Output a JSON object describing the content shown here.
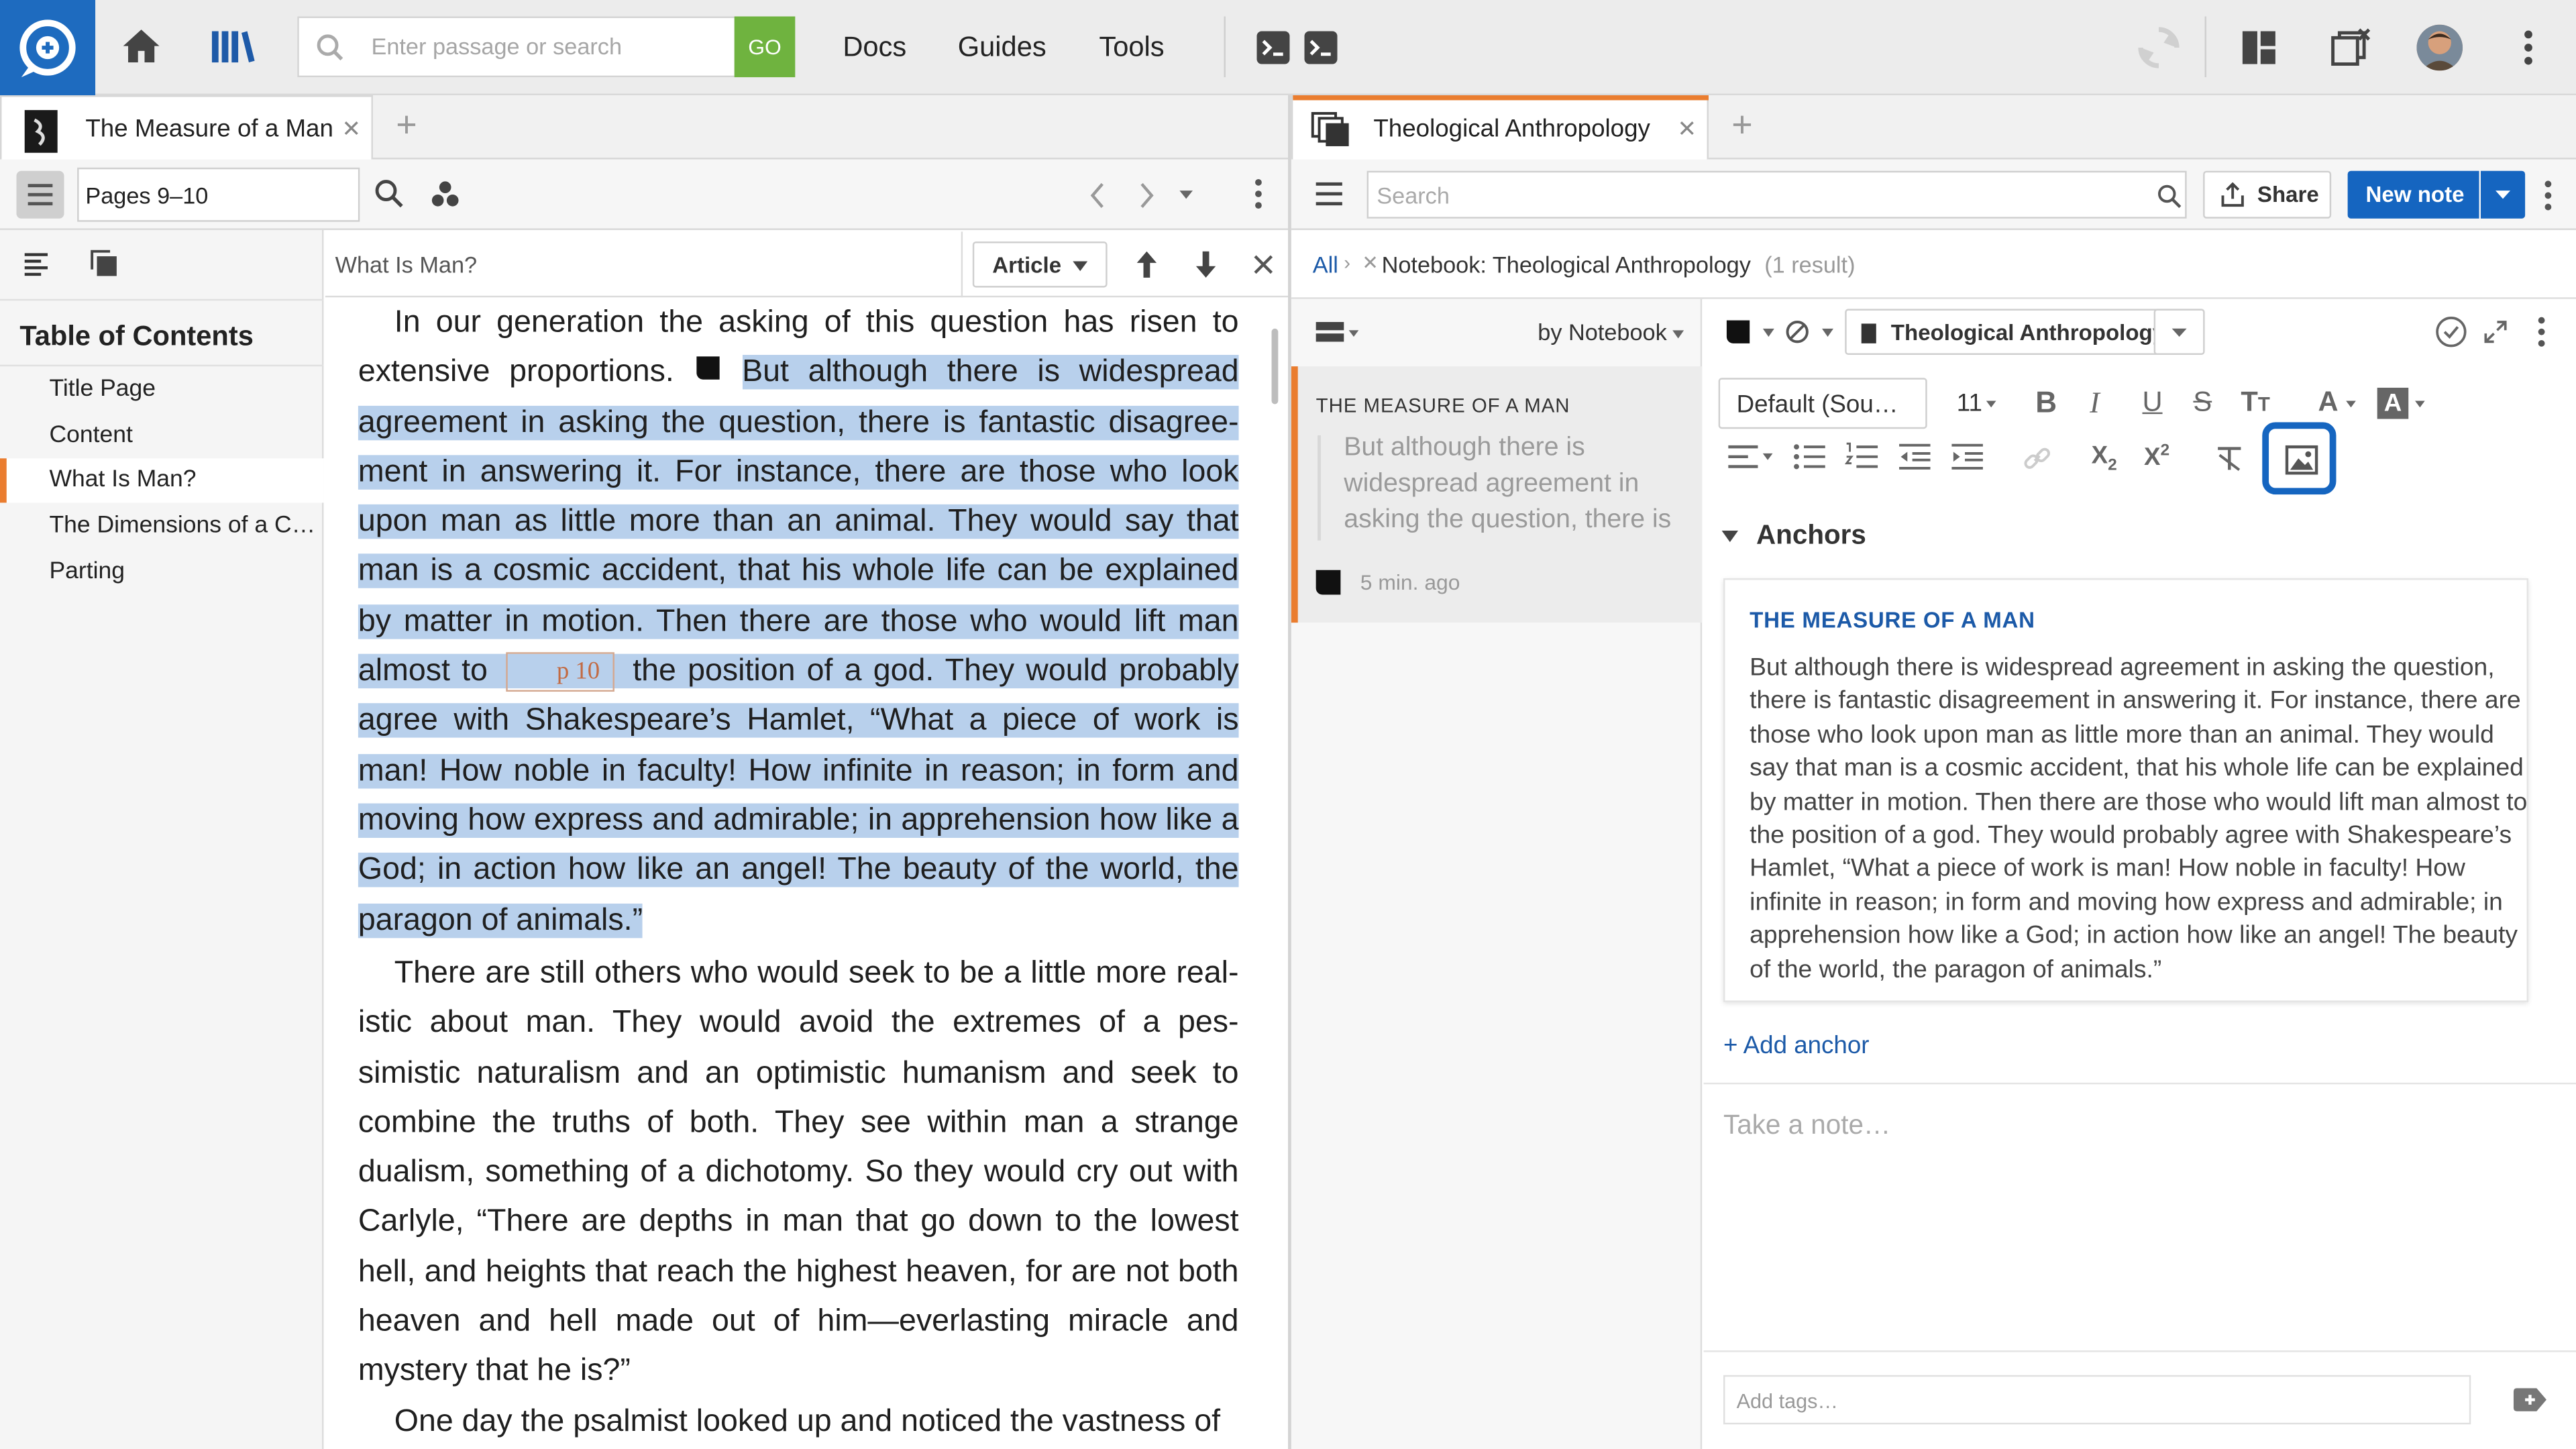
{
  "topbar": {
    "search_placeholder": "Enter passage or search",
    "go_label": "GO",
    "nav": [
      "Docs",
      "Guides",
      "Tools"
    ]
  },
  "left_panel": {
    "tab_title": "The Measure of a Man",
    "reference": "Pages 9–10",
    "toc_heading": "Table of Contents",
    "toc_items": [
      "Title Page",
      "Content",
      "What Is Man?",
      "The Dimensions of a C…",
      "Parting"
    ],
    "toc_active_index": 2,
    "find_value": "What Is Man?",
    "find_scope": "Article",
    "article": {
      "p1_a": "In our generation the asking of this question has risen to extensive proportions.",
      "p1_b": "But although there is widespread agreement in asking the question, there is fantastic disagree­ment in answering it. For instance, there are those who look upon man as little more than an animal. They would say that man is a cosmic accident, that his whole life can be explained by matter in motion. Then there are those who would lift man almost to",
      "page_marker": "p 10",
      "p1_c": "the position of a god. They would probably agree with Shakespeare’s Hamlet, “What a piece of work is man! How noble in faculty! How infinite in reason; in form and moving how express and admirable; in apprehension how like a God; in action how like an angel! The beauty of the world, the paragon of animals.”",
      "p2": "There are still others who would seek to be a little more real­istic about man. They would avoid the extremes of a pes­simistic naturalism and an optimistic humanism and seek to combine the truths of both. They see within man a strange dual­ism, something of a dichotomy. So they would cry out with Carlyle, “There are depths in man that go down to the lowest hell, and heights that reach the highest heaven, for are not both heaven and hell made out of him—everlasting miracle and mystery that he is?”",
      "p3": "One day the psalmist looked up and noticed the vastness of"
    }
  },
  "right_panel": {
    "tab_title": "Theological Anthropology",
    "search_placeholder": "Search",
    "share_label": "Share",
    "new_note_label": "New note",
    "breadcrumb": {
      "all": "All",
      "notebook": "Notebook: Theological Anthropology",
      "count": "(1 result)"
    },
    "sort_label": "by Notebook",
    "note_card": {
      "source": "THE MEASURE OF A MAN",
      "excerpt": "But although there is widespread agreement in asking the question, there is",
      "time": "5 min. ago"
    },
    "editor": {
      "notebook": "Theological Anthropology",
      "font": "Default (Sou…",
      "size": "11",
      "anchors_heading": "Anchors",
      "anchor_title": "THE MEASURE OF A MAN",
      "anchor_text": "But although there is widespread agreement in asking the question, there is fantastic disagreement in answering it. For instance, there are those who look upon man as little more than an animal. They would say that man is a cosmic accident, that his whole life can be explained by matter in motion. Then there are those who would lift man almost to the position of a god. They would probably agree with Shakespeare’s Hamlet, “What a piece of work is man! How noble in faculty! How infinite in reason; in form and moving how express and admirable; in apprehension how like a God; in action how like an angel! The beauty of the world, the paragon of animals.”",
      "add_anchor": "+ Add anchor",
      "note_placeholder": "Take a note…",
      "tags_placeholder": "Add tags…"
    }
  },
  "colors": {
    "accent": "#1e6bbf",
    "go": "#6fb33f",
    "highlight": "#b8d0ec",
    "tab_active": "#ea7d2f",
    "new_note": "#1565c0"
  }
}
